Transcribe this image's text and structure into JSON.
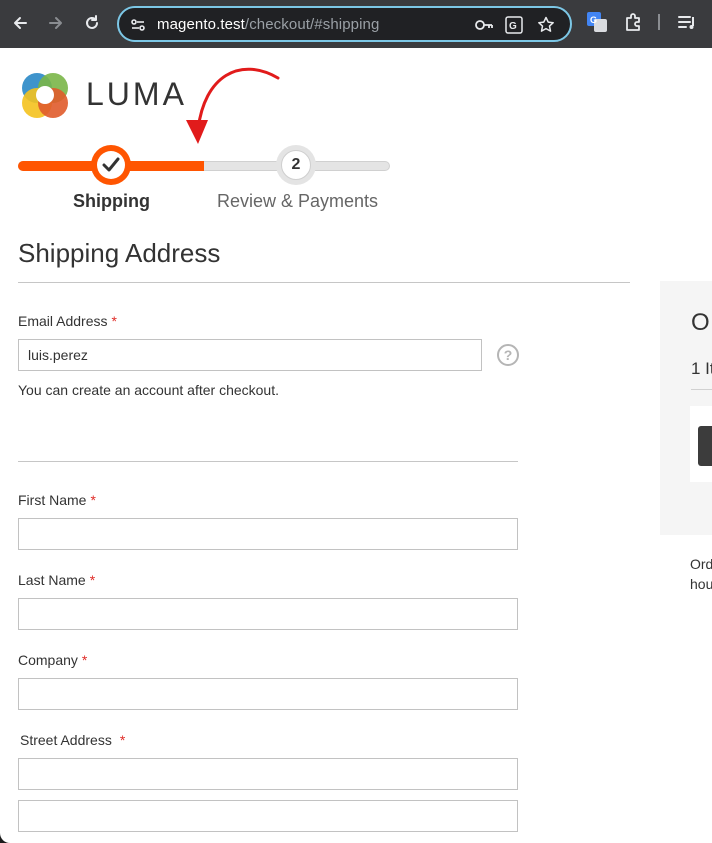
{
  "browser": {
    "url_host": "magento.test",
    "url_path": "/checkout/#shipping"
  },
  "logo": {
    "text": "LUMA"
  },
  "progress": {
    "steps": [
      {
        "label": "Shipping",
        "state": "complete"
      },
      {
        "number": "2",
        "label": "Review & Payments",
        "state": "pending"
      }
    ],
    "fill_fraction": 0.5
  },
  "shipping": {
    "title": "Shipping Address",
    "fields": {
      "email": {
        "label": "Email Address",
        "required": "*",
        "value": "luis.perez",
        "help": "?"
      },
      "first_name": {
        "label": "First Name",
        "required": "*",
        "value": ""
      },
      "last_name": {
        "label": "Last Name",
        "required": "*",
        "value": ""
      },
      "company": {
        "label": "Company",
        "required": "*",
        "value": ""
      },
      "street": {
        "label": "Street Address",
        "required": "*",
        "line1": "",
        "line2": ""
      }
    },
    "email_note": "You can create an account after checkout."
  },
  "summary": {
    "title": "O",
    "count": "1 It",
    "side_line1": "Ord",
    "side_line2": "hou"
  },
  "colors": {
    "accent": "#ff5501",
    "required": "#e02b27",
    "omnibox_border": "#7cc7e6"
  }
}
